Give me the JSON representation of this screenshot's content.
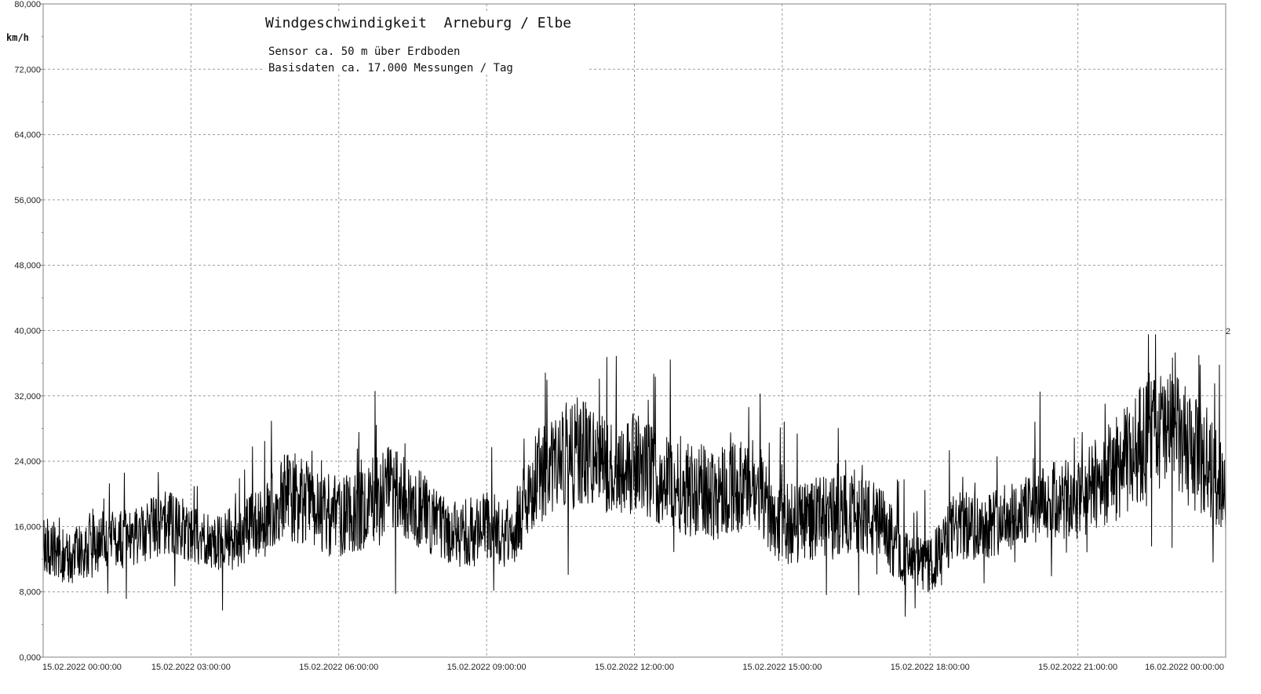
{
  "chart_data": {
    "type": "line",
    "title": "Windgeschwindigkeit  Arneburg / Elbe",
    "subtitle_lines": [
      "Sensor ca. 50 m über Erdboden",
      "Basisdaten ca. 17.000 Messungen / Tag"
    ],
    "ylabel": "km/h",
    "ylim": [
      0,
      80
    ],
    "yticks": [
      "0,000",
      "8,000",
      "16,000",
      "24,000",
      "32,000",
      "40,000",
      "48,000",
      "56,000",
      "64,000",
      "72,000",
      "80,000"
    ],
    "xlim": [
      0,
      24
    ],
    "xticks": [
      {
        "x": 0,
        "label": "15.02.2022  00:00:00"
      },
      {
        "x": 3,
        "label": "15.02.2022  03:00:00"
      },
      {
        "x": 6,
        "label": "15.02.2022  06:00:00"
      },
      {
        "x": 9,
        "label": "15.02.2022  09:00:00"
      },
      {
        "x": 12,
        "label": "15.02.2022  12:00:00"
      },
      {
        "x": 15,
        "label": "15.02.2022  15:00:00"
      },
      {
        "x": 18,
        "label": "15.02.2022  18:00:00"
      },
      {
        "x": 21,
        "label": "15.02.2022  21:00:00"
      },
      {
        "x": 24,
        "label": "16.02.2022  00:00:00"
      }
    ],
    "right_edge_label": "2",
    "grid": true,
    "series": [
      {
        "color": "#000000",
        "x": [
          0,
          0.5,
          1,
          1.5,
          2,
          2.5,
          3,
          3.5,
          4,
          4.5,
          5,
          5.5,
          6,
          6.5,
          7,
          7.5,
          8,
          8.5,
          9,
          9.5,
          10,
          10.5,
          11,
          11.5,
          12,
          12.5,
          13,
          13.5,
          14,
          14.5,
          15,
          15.5,
          16,
          16.5,
          17,
          17.5,
          18,
          18.5,
          19,
          19.5,
          20,
          20.5,
          21,
          21.5,
          22,
          22.5,
          23,
          23.5,
          24
        ],
        "y": [
          14,
          12,
          14,
          14.5,
          15,
          17,
          15,
          14,
          15,
          17,
          20,
          18,
          17,
          19,
          20,
          19,
          16,
          15,
          16,
          15,
          22,
          24,
          25,
          23,
          24,
          22,
          21,
          20,
          21,
          20,
          16,
          17,
          17,
          18,
          16,
          12,
          11,
          16,
          16,
          17,
          18,
          19,
          19,
          22,
          24,
          28,
          27,
          24,
          21
        ],
        "spread": [
          4,
          4,
          5,
          4,
          4,
          5,
          4,
          4,
          5,
          5,
          7,
          6,
          6,
          7,
          7,
          6,
          5,
          5,
          5,
          5,
          7,
          7,
          8,
          7,
          7,
          7,
          7,
          7,
          7,
          6,
          6,
          6,
          6,
          6,
          6,
          4,
          4,
          5,
          5,
          5,
          5,
          6,
          6,
          7,
          8,
          9,
          9,
          8,
          7
        ]
      }
    ]
  }
}
